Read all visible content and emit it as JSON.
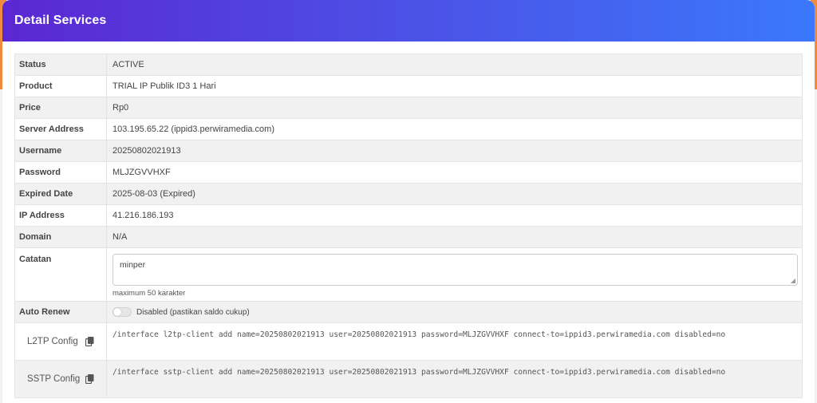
{
  "header": {
    "title": "Detail Services"
  },
  "rows": {
    "status": {
      "label": "Status",
      "value": "ACTIVE"
    },
    "product": {
      "label": "Product",
      "value": "TRIAL IP Publik ID3 1 Hari"
    },
    "price": {
      "label": "Price",
      "value": "Rp0"
    },
    "server_address": {
      "label": "Server Address",
      "value": "103.195.65.22 (ippid3.perwiramedia.com)"
    },
    "username": {
      "label": "Username",
      "value": "20250802021913"
    },
    "password": {
      "label": "Password",
      "value": "MLJZGVVHXF"
    },
    "expired_date": {
      "label": "Expired Date",
      "value": "2025-08-03 (Expired)"
    },
    "ip_address": {
      "label": "IP Address",
      "value": "41.216.186.193"
    },
    "domain": {
      "label": "Domain",
      "value": "N/A"
    }
  },
  "catatan": {
    "label": "Catatan",
    "value": "minper",
    "hint": "maximum 50 karakter"
  },
  "auto_renew": {
    "label": "Auto Renew",
    "status_text": "Disabled (pastikan saldo cukup)",
    "enabled": false
  },
  "configs": {
    "l2tp": {
      "label": "L2TP Config",
      "icon": "copy-icon",
      "command": "/interface l2tp-client add name=20250802021913 user=20250802021913 password=MLJZGVVHXF connect-to=ippid3.perwiramedia.com disabled=no"
    },
    "sstp": {
      "label": "SSTP Config",
      "icon": "copy-icon",
      "command": "/interface sstp-client add name=20250802021913 user=20250802021913 password=MLJZGVVHXF connect-to=ippid3.perwiramedia.com disabled=no"
    }
  },
  "colors": {
    "header_start": "#5b27d2",
    "header_end": "#3b78fb",
    "active": "#2fb344",
    "accent_side": "#f08a3c"
  }
}
